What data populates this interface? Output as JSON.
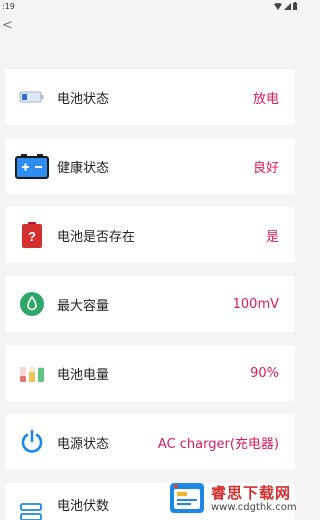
{
  "status_bar": {
    "time": ":19"
  },
  "app_bar": {
    "back_glyph": "<"
  },
  "rows": [
    {
      "label": "电池状态",
      "value": "放电",
      "icon": "battery-icon"
    },
    {
      "label": "健康状态",
      "value": "良好",
      "icon": "battery-health-icon"
    },
    {
      "label": "电池是否存在",
      "value": "是",
      "icon": "battery-present-icon"
    },
    {
      "label": "最大容量",
      "value": "100mV",
      "icon": "capacity-drop-icon"
    },
    {
      "label": "电池电量",
      "value": "90%",
      "icon": "battery-level-icon"
    },
    {
      "label": "电源状态",
      "value": "AC charger(充电器)",
      "icon": "power-icon"
    },
    {
      "label": "电池伏数",
      "value": "",
      "icon": "voltage-icon"
    }
  ],
  "watermark": {
    "title": "睿思下载网",
    "url": "www.cdgthk.com"
  },
  "colors": {
    "accent": "#d81b60",
    "background": "#f4f4f4",
    "card": "#ffffff"
  }
}
